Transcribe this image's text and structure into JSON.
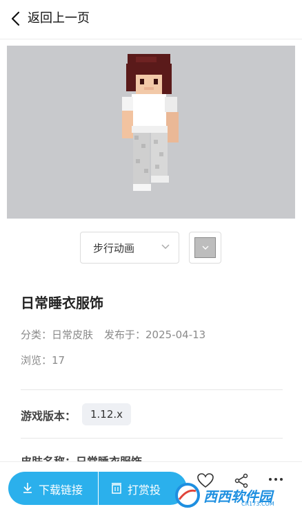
{
  "header": {
    "back_label": "返回上一页"
  },
  "controls": {
    "animation_label": "步行动画"
  },
  "info": {
    "title": "日常睡衣服饰",
    "category": "分类：日常皮肤",
    "published": "发布于：2025-04-13",
    "views": "浏览：17"
  },
  "version": {
    "label": "游戏版本：",
    "value": "1.12.x"
  },
  "skin_name": {
    "text": "皮肤名称：日常睡衣服饰"
  },
  "bottom": {
    "download_label": "下载链接",
    "reward_label": "打赏投",
    "favorite_label": "",
    "share_label": "",
    "more_label": ""
  },
  "watermark": {
    "text": "西西软件园",
    "sub": "CR173.COM"
  },
  "colors": {
    "accent": "#2bb0ec",
    "preview_bg": "#c8c9cc"
  }
}
